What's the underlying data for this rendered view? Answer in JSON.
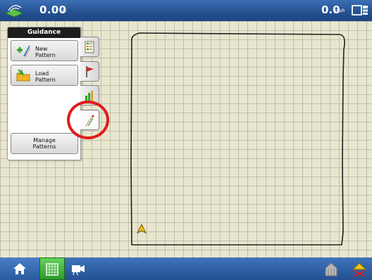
{
  "topbar": {
    "area_value": "0.00",
    "area_unit": "ac",
    "speed_value": "0.0",
    "speed_unit": "mph",
    "icons": [
      "gps-status-icon",
      "screen-layout-icon"
    ]
  },
  "guidance": {
    "title": "Guidance",
    "new_pattern_label": [
      "New",
      "Pattern"
    ],
    "load_pattern_label": [
      "Load",
      "Pattern"
    ],
    "manage_patterns_label": [
      "Manage",
      "Patterns"
    ]
  },
  "tabs": [
    "field-list-icon",
    "flag-icon",
    "chart-icon",
    "guidance-line-icon"
  ],
  "bottom_nav": [
    "home-icon",
    "map-grid-icon",
    "camera-icon",
    "grain-bin-icon",
    "warning-icon"
  ],
  "colors": {
    "topbar": "#24508f",
    "map_bg": "#e8e6cf",
    "highlight_circle": "#e11a1a",
    "active_nav": "#3fae3a"
  }
}
